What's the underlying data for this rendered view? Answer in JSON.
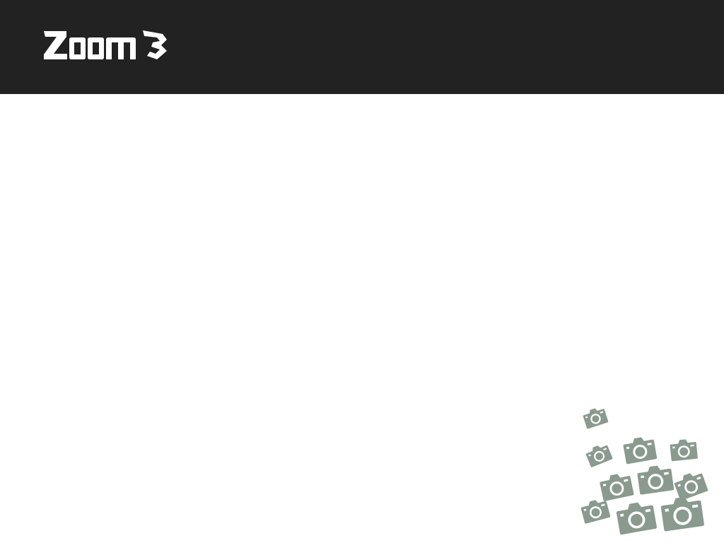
{
  "app": {
    "brand_name": "Zoom3",
    "logo_icon": "zoom3-logo-icon",
    "decoration_icon": "camera-cluster-icon"
  },
  "colors": {
    "header_bg": "#222222",
    "logo_fg": "#ffffff",
    "page_bg": "#ffffff",
    "camera_fill": "#8a9a8e"
  }
}
